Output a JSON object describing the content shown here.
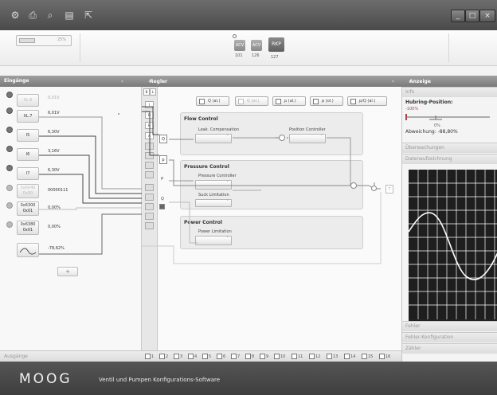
{
  "window": {
    "minimize": "_",
    "maximize": "□",
    "close": "×"
  },
  "toolbar": {
    "icons": [
      "settings-icon",
      "print-icon",
      "search-icon",
      "save-icon",
      "export-icon"
    ]
  },
  "network": {
    "percent": "25%"
  },
  "devices": [
    {
      "label": "ACV",
      "number": "101"
    },
    {
      "label": "ACV",
      "number": "126"
    },
    {
      "label": "RKP",
      "number": "127"
    }
  ],
  "panels": {
    "inputs": "Eingänge",
    "controller": "Regler",
    "display": "Anzeige",
    "outputs": "Ausgänge"
  },
  "inputs": [
    {
      "name": "XL.6",
      "value": "0,01V",
      "dim": true
    },
    {
      "name": "XL.7",
      "value": "6,01V",
      "dim": false
    },
    {
      "name": "I5",
      "value": "6,30V",
      "dim": false
    },
    {
      "name": "I6",
      "value": "3,16V",
      "dim": false
    },
    {
      "name": "I7",
      "value": "6,30V",
      "dim": false
    },
    {
      "name": "0x6040\n0x00",
      "value": "00000111",
      "dim": true
    },
    {
      "name": "0x6300\n0x01",
      "value": "0,00%",
      "dim": false
    },
    {
      "name": "0x6380\n0x01",
      "value": "0,00%",
      "dim": false
    },
    {
      "name": "",
      "value": "-78,62%",
      "dim": false
    }
  ],
  "add_label": "+",
  "tools": [
    "B",
    "L",
    "I",
    "D",
    "H",
    "A"
  ],
  "center": {
    "mode_buttons": [
      "Q (al.)",
      "Q (ol.)",
      "p (al.)",
      "p (ol.)",
      "p/Q (al.)"
    ],
    "flow_control": {
      "title": "Flow Control",
      "leak": "Leak. Compensation",
      "position": "Position Controller"
    },
    "pressure_control": {
      "title": "Pressure Control",
      "pressure": "Pressure Controller",
      "suck": "Suck Limitation"
    },
    "power_control": {
      "title": "Power Control",
      "power": "Power Limitation"
    },
    "labels": {
      "q": "Q",
      "p": "p",
      "p2": "p",
      "q2": "Q",
      "t": "T"
    },
    "channels": [
      "1",
      "2",
      "3",
      "4",
      "5",
      "6",
      "7",
      "8",
      "9",
      "10",
      "11",
      "12",
      "13",
      "14",
      "15",
      "16"
    ]
  },
  "info": {
    "sections": [
      "Info",
      "Überwachungen",
      "Datenaufzeichnung",
      "Fehler",
      "Fehler-Konfiguration",
      "Zähler"
    ],
    "hub_title": "Hubring-Position:",
    "hub_value": "-100%",
    "slider_mid": "0%",
    "deviation": "Abweichung: -88,80%"
  },
  "footer": {
    "logo": "MOOG",
    "tagline": "Ventil und Pumpen Konfigurations-Software"
  }
}
